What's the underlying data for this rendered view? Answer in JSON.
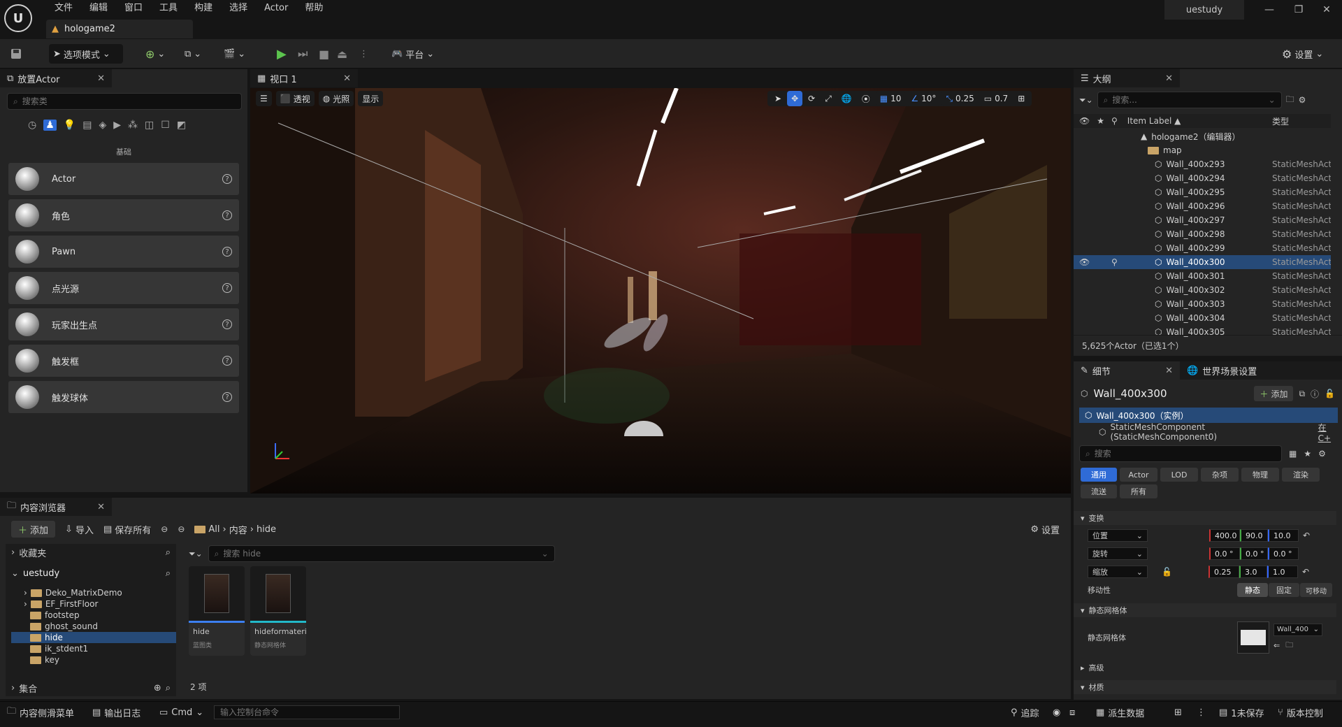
{
  "app": {
    "user": "uestudy",
    "logo": "U"
  },
  "menu": [
    "文件",
    "编辑",
    "窗口",
    "工具",
    "构建",
    "选择",
    "Actor",
    "帮助"
  ],
  "doc_tab": "hologame2",
  "toolbar": {
    "mode": "选项模式",
    "platform": "平台",
    "settings": "设置"
  },
  "place_actor": {
    "title": "放置Actor",
    "search_placeholder": "搜索类",
    "category": "基础",
    "items": [
      "Actor",
      "角色",
      "Pawn",
      "点光源",
      "玩家出生点",
      "触发框",
      "触发球体"
    ]
  },
  "viewport": {
    "tab": "视口 1",
    "perspective": "透视",
    "lit": "光照",
    "show": "显示",
    "grid": "10",
    "angle": "10°",
    "scale": "0.25",
    "camera": "0.7"
  },
  "outliner": {
    "title": "大纲",
    "search_placeholder": "搜索...",
    "col_label": "Item Label ▲",
    "col_type": "类型",
    "root": "hologame2（编辑器）",
    "folder": "map",
    "rows": [
      {
        "name": "Wall_400x293",
        "type": "StaticMeshActor"
      },
      {
        "name": "Wall_400x294",
        "type": "StaticMeshActor"
      },
      {
        "name": "Wall_400x295",
        "type": "StaticMeshActor"
      },
      {
        "name": "Wall_400x296",
        "type": "StaticMeshActor"
      },
      {
        "name": "Wall_400x297",
        "type": "StaticMeshActor"
      },
      {
        "name": "Wall_400x298",
        "type": "StaticMeshActor"
      },
      {
        "name": "Wall_400x299",
        "type": "StaticMeshActor"
      },
      {
        "name": "Wall_400x300",
        "type": "StaticMeshActor"
      },
      {
        "name": "Wall_400x301",
        "type": "StaticMeshActor"
      },
      {
        "name": "Wall_400x302",
        "type": "StaticMeshActor"
      },
      {
        "name": "Wall_400x303",
        "type": "StaticMeshActor"
      },
      {
        "name": "Wall_400x304",
        "type": "StaticMeshActor"
      },
      {
        "name": "Wall_400x305",
        "type": "StaticMeshActor"
      }
    ],
    "count": "5,625个Actor（已选1个）"
  },
  "details": {
    "title": "细节",
    "world_tab": "世界场景设置",
    "actor": "Wall_400x300",
    "add": "添加",
    "instance": "Wall_400x300（实例）",
    "component": "StaticMeshComponent (StaticMeshComponent0)",
    "component_link": "在C+",
    "search_placeholder": "搜索",
    "tabs": [
      "通用",
      "Actor",
      "LOD",
      "杂项",
      "物理",
      "渲染",
      "流送",
      "所有"
    ],
    "transform": "变换",
    "location": {
      "label": "位置",
      "x": "400.0",
      "y": "90.0",
      "z": "10.0"
    },
    "rotation": {
      "label": "旋转",
      "x": "0.0 °",
      "y": "0.0 °",
      "z": "0.0 °"
    },
    "scale": {
      "label": "缩放",
      "x": "0.25",
      "y": "3.0",
      "z": "1.0"
    },
    "mobility": {
      "label": "移动性",
      "opts": [
        "静态",
        "固定",
        "可移动"
      ]
    },
    "static_mesh_section": "静态网格体",
    "static_mesh_label": "静态网格体",
    "mesh_value": "Wall_400",
    "advanced": "高级",
    "more": "材质"
  },
  "content": {
    "title": "内容浏览器",
    "add": "添加",
    "import": "导入",
    "save_all": "保存所有",
    "path": [
      "All",
      "内容",
      "hide"
    ],
    "settings": "设置",
    "favorites": "收藏夹",
    "project": "uestudy",
    "collections": "集合",
    "folders": [
      "Deko_MatrixDemo",
      "EF_FirstFloor",
      "footstep",
      "ghost_sound",
      "hide",
      "ik_stdent1",
      "key"
    ],
    "search_placeholder": "搜索 hide",
    "assets": [
      {
        "name": "hide",
        "type": "蓝图类"
      },
      {
        "name": "hideformateri...",
        "type": "静态网格体"
      }
    ],
    "count": "2 项"
  },
  "statusbar": {
    "drawer": "内容侧滑菜单",
    "log": "输出日志",
    "cmd": "Cmd",
    "cmd_placeholder": "输入控制台命令",
    "trace": "追踪",
    "derived": "派生数据",
    "unsaved": "1未保存",
    "source": "版本控制"
  }
}
